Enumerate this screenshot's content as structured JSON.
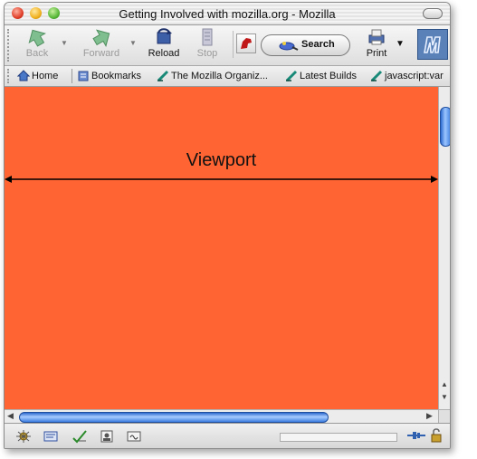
{
  "window": {
    "title": "Getting Involved with mozilla.org - Mozilla"
  },
  "toolbar": {
    "back_label": "Back",
    "forward_label": "Forward",
    "reload_label": "Reload",
    "stop_label": "Stop",
    "search_label": "Search",
    "print_label": "Print"
  },
  "personal_toolbar": {
    "items": [
      {
        "label": "Home",
        "icon": "home-icon"
      },
      {
        "label": "Bookmarks",
        "icon": "bookmarks-icon"
      },
      {
        "label": "The Mozilla Organiz...",
        "icon": "bookmark-link-icon"
      },
      {
        "label": "Latest Builds",
        "icon": "bookmark-link-icon"
      },
      {
        "label": "javascript:var",
        "icon": "bookmark-link-icon"
      }
    ]
  },
  "content": {
    "label": "Viewport",
    "background": "#ff6432"
  },
  "colors": {
    "scrollbar_accent": "#3c7ee0"
  }
}
